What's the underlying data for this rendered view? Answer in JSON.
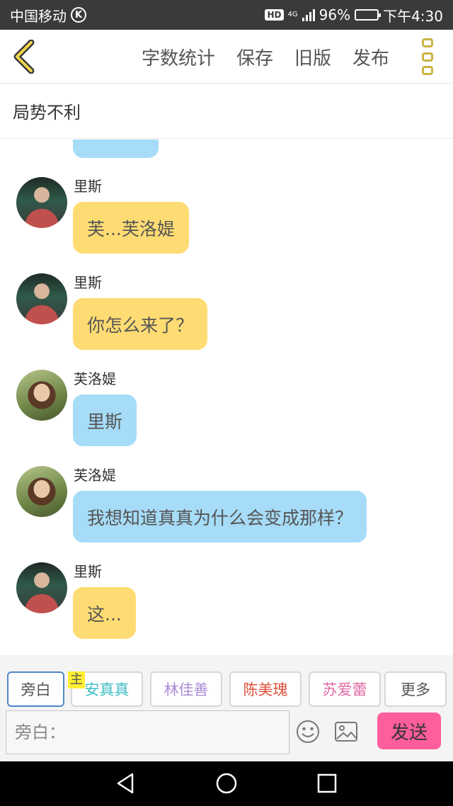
{
  "status_bar": {
    "carrier": "中国移动",
    "carrier_badge": "K",
    "hd": "HD",
    "network": "4G",
    "battery": "96%",
    "battery_level": 0.96,
    "time": "下午4:30"
  },
  "toolbar": {
    "actions": [
      "字数统计",
      "保存",
      "旧版",
      "发布"
    ],
    "accent_color": "#c9b443"
  },
  "title": "局势不利",
  "messages": [
    {
      "name": "里斯",
      "avatar": "lisi",
      "text": "芙...芙洛媞",
      "color": "yellow"
    },
    {
      "name": "里斯",
      "avatar": "lisi",
      "text": "你怎么来了？",
      "color": "yellow"
    },
    {
      "name": "芙洛媞",
      "avatar": "fuluo",
      "text": "里斯",
      "color": "blue"
    },
    {
      "name": "芙洛媞",
      "avatar": "fuluo",
      "text": "我想知道真真为什么会变成那样？",
      "color": "blue"
    },
    {
      "name": "里斯",
      "avatar": "lisi",
      "text": "这...",
      "color": "yellow"
    }
  ],
  "roles": [
    {
      "label": "旁白",
      "color": "#555555",
      "selected": true
    },
    {
      "label": "安真真",
      "color": "#3cbcc4",
      "selected": false
    },
    {
      "label": "林佳善",
      "color": "#a98bd6",
      "selected": false
    },
    {
      "label": "陈美瑰",
      "color": "#e0503a",
      "selected": false
    },
    {
      "label": "苏爱蕾",
      "color": "#e06aa4",
      "selected": false
    },
    {
      "label": "更多",
      "color": "#555555",
      "selected": false
    }
  ],
  "host_tag": "主",
  "input": {
    "placeholder": "旁白："
  },
  "send_label": "发送",
  "colors": {
    "yellow_bubble": "#ffdc73",
    "blue_bubble": "#a6dcf7",
    "send_button": "#ff5e9c"
  }
}
